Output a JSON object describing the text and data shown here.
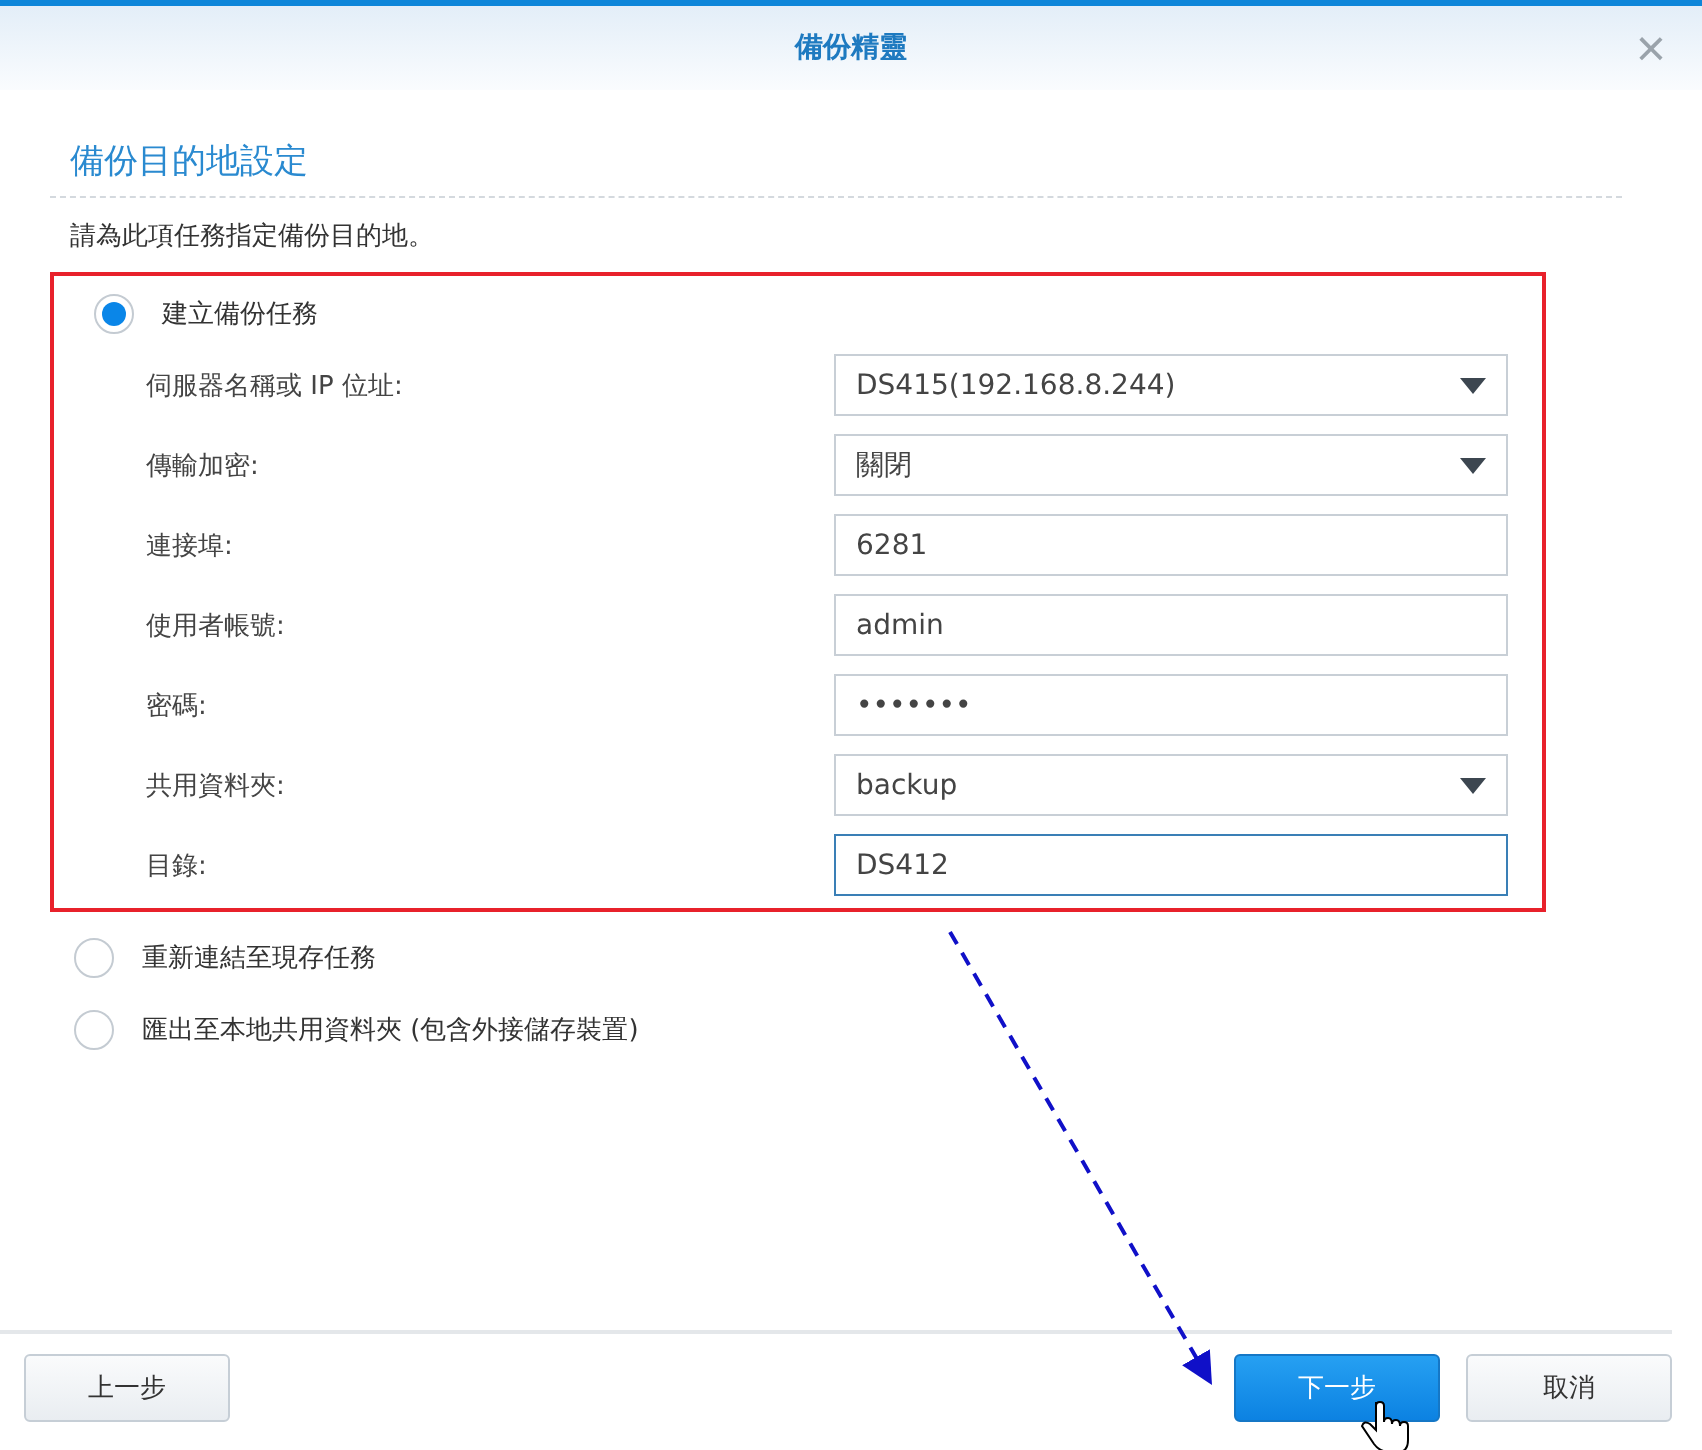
{
  "window": {
    "title": "備份精靈",
    "close": "×"
  },
  "section": {
    "title": "備份目的地設定",
    "description": "請為此項任務指定備份目的地。"
  },
  "options": [
    {
      "label": "建立備份任務",
      "selected": true,
      "fields": [
        {
          "label": "伺服器名稱或 IP 位址:",
          "kind": "select",
          "value": "DS415(192.168.8.244)",
          "focused": false
        },
        {
          "label": "傳輸加密:",
          "kind": "select",
          "value": "關閉",
          "focused": false
        },
        {
          "label": "連接埠:",
          "kind": "text",
          "value": "6281",
          "focused": false
        },
        {
          "label": "使用者帳號:",
          "kind": "text",
          "value": "admin",
          "focused": false
        },
        {
          "label": "密碼:",
          "kind": "password",
          "value": "•••••••",
          "focused": false
        },
        {
          "label": "共用資料夾:",
          "kind": "select",
          "value": "backup",
          "focused": false
        },
        {
          "label": "目錄:",
          "kind": "text",
          "value": "DS412",
          "focused": true
        }
      ]
    },
    {
      "label": "重新連結至現存任務",
      "selected": false
    },
    {
      "label": "匯出至本地共用資料夾 (包含外接儲存裝置)",
      "selected": false
    }
  ],
  "buttons": [
    {
      "label": "上一步",
      "kind": "plain"
    },
    {
      "label": "下一步",
      "kind": "primary"
    },
    {
      "label": "取消",
      "kind": "plain"
    }
  ]
}
